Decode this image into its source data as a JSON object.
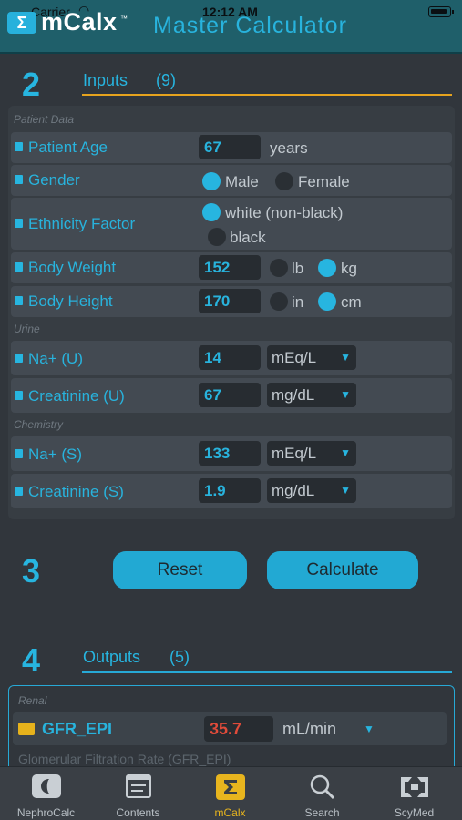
{
  "status_bar": {
    "carrier": "Carrier",
    "time": "12:12 AM"
  },
  "header": {
    "logo_glyph": "Σ",
    "logo_text": "mCalx",
    "trademark": "™",
    "title": "Master Calculator"
  },
  "inputs": {
    "number": "2",
    "title": "Inputs",
    "count": "(9)",
    "groups": {
      "patient": "Patient Data",
      "urine": "Urine",
      "chemistry": "Chemistry"
    },
    "rows": {
      "age": {
        "label": "Patient Age",
        "value": "67",
        "unit": "years"
      },
      "gender": {
        "label": "Gender",
        "options": [
          "Male",
          "Female"
        ],
        "selected": "Male"
      },
      "ethnicity": {
        "label": "Ethnicity Factor",
        "options": [
          "white (non-black)",
          "black"
        ],
        "selected": "white (non-black)"
      },
      "weight": {
        "label": "Body Weight",
        "value": "152",
        "units": [
          "lb",
          "kg"
        ],
        "selected": "kg"
      },
      "height": {
        "label": "Body Height",
        "value": "170",
        "units": [
          "in",
          "cm"
        ],
        "selected": "cm"
      },
      "na_u": {
        "label": "Na+ (U)",
        "value": "14",
        "unit": "mEq/L"
      },
      "cr_u": {
        "label": "Creatinine (U)",
        "value": "67",
        "unit": "mg/dL"
      },
      "na_s": {
        "label": "Na+ (S)",
        "value": "133",
        "unit": "mEq/L"
      },
      "cr_s": {
        "label": "Creatinine (S)",
        "value": "1.9",
        "unit": "mg/dL"
      }
    }
  },
  "actions": {
    "number": "3",
    "reset_label": "Reset",
    "calculate_label": "Calculate"
  },
  "outputs": {
    "number": "4",
    "title": "Outputs",
    "count": "(5)",
    "group": "Renal",
    "gfr": {
      "label": "GFR_EPI",
      "value": "35.7",
      "unit": "mL/min",
      "description": "Glomerular Filtration Rate (GFR_EPI)"
    }
  },
  "tabs": [
    "NephroCalc",
    "Contents",
    "mCalx",
    "Search",
    "ScyMed"
  ],
  "active_tab": "mCalx",
  "colors": {
    "accent": "#27b5e0",
    "header": "#1f5f6a",
    "background": "#31363c",
    "active_tab": "#e8b51e",
    "alert_value": "#e04b3a"
  }
}
